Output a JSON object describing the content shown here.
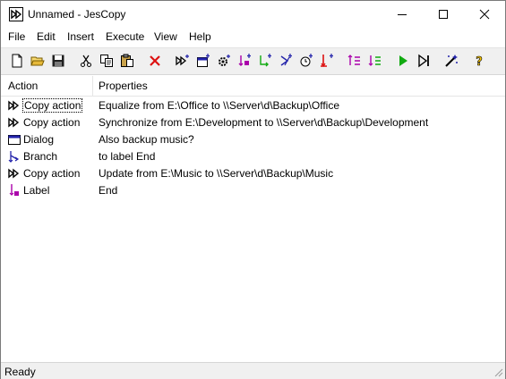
{
  "window": {
    "title": "Unnamed - JesCopy"
  },
  "menu": [
    "File",
    "Edit",
    "Insert",
    "Execute",
    "View",
    "Help"
  ],
  "toolbar": [
    {
      "name": "new-icon"
    },
    {
      "name": "open-icon"
    },
    {
      "name": "save-icon"
    },
    {
      "name": "cut-icon"
    },
    {
      "name": "copy-icon"
    },
    {
      "name": "paste-icon"
    },
    {
      "name": "delete-icon"
    },
    {
      "name": "insert-copy-action-icon"
    },
    {
      "name": "insert-dialog-icon"
    },
    {
      "name": "insert-settings-icon"
    },
    {
      "name": "insert-branch-icon"
    },
    {
      "name": "insert-branch-alt-icon"
    },
    {
      "name": "insert-condition-icon"
    },
    {
      "name": "insert-timer-icon"
    },
    {
      "name": "insert-label-icon"
    },
    {
      "name": "move-up-icon"
    },
    {
      "name": "move-down-icon"
    },
    {
      "name": "run-icon"
    },
    {
      "name": "step-icon"
    },
    {
      "name": "wizard-icon"
    },
    {
      "name": "help-icon"
    }
  ],
  "columns": {
    "action": "Action",
    "properties": "Properties"
  },
  "rows": [
    {
      "icon": "copy-action-icon",
      "action": "Copy action",
      "properties": "Equalize from E:\\Office to \\\\Server\\d\\Backup\\Office"
    },
    {
      "icon": "copy-action-icon",
      "action": "Copy action",
      "properties": "Synchronize from E:\\Development to \\\\Server\\d\\Backup\\Development"
    },
    {
      "icon": "dialog-icon",
      "action": "Dialog",
      "properties": "Also backup music?"
    },
    {
      "icon": "branch-icon",
      "action": "Branch",
      "properties": "to label End"
    },
    {
      "icon": "copy-action-icon",
      "action": "Copy action",
      "properties": "Update from E:\\Music to \\\\Server\\d\\Backup\\Music"
    },
    {
      "icon": "label-icon",
      "action": "Label",
      "properties": "End"
    }
  ],
  "status": "Ready"
}
